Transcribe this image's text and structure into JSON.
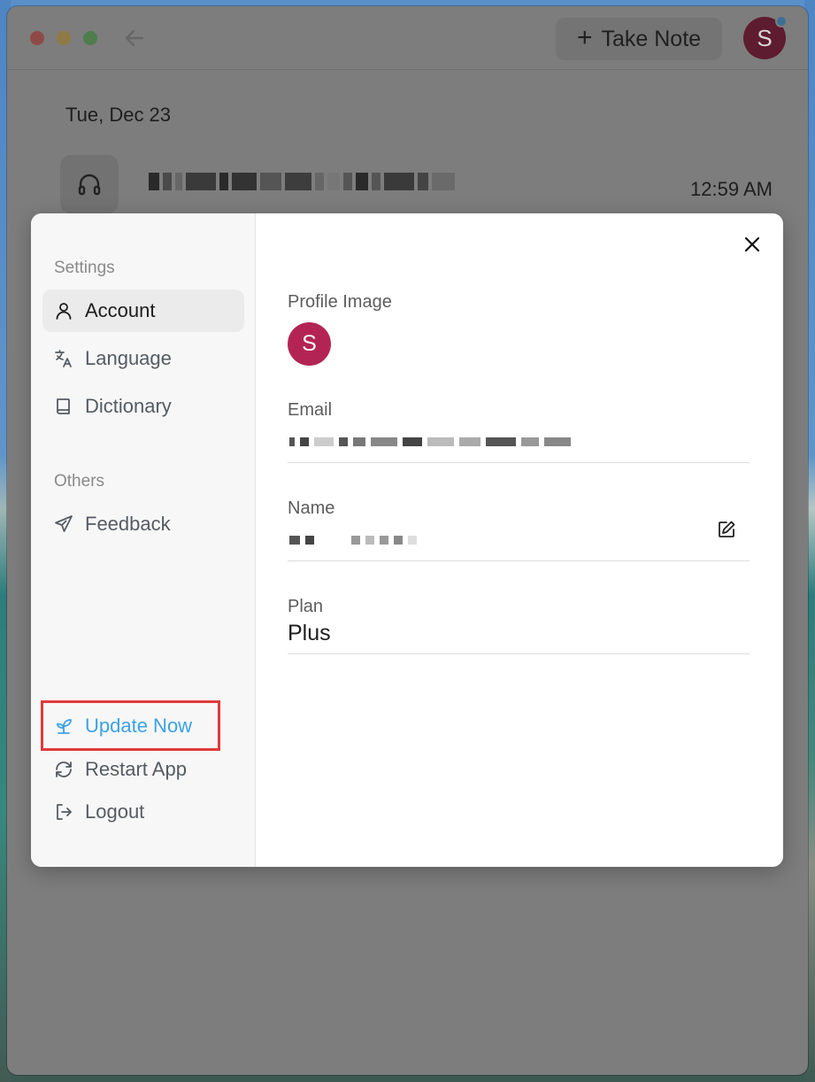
{
  "titlebar": {
    "take_note_label": "Take Note",
    "avatar_initial": "S"
  },
  "notes": {
    "date_heading": "Tue, Dec 23",
    "items": [
      {
        "time": "12:59 AM"
      }
    ]
  },
  "settings": {
    "sections": {
      "settings_label": "Settings",
      "others_label": "Others"
    },
    "nav": {
      "account": "Account",
      "language": "Language",
      "dictionary": "Dictionary",
      "feedback": "Feedback",
      "update": "Update Now",
      "restart": "Restart App",
      "logout": "Logout"
    },
    "account": {
      "profile_image_label": "Profile Image",
      "avatar_initial": "S",
      "email_label": "Email",
      "name_label": "Name",
      "plan_label": "Plan",
      "plan_value": "Plus"
    }
  },
  "colors": {
    "accent_blue": "#3ba2e6",
    "avatar": "#b32455",
    "highlight": "#e03a3a"
  }
}
